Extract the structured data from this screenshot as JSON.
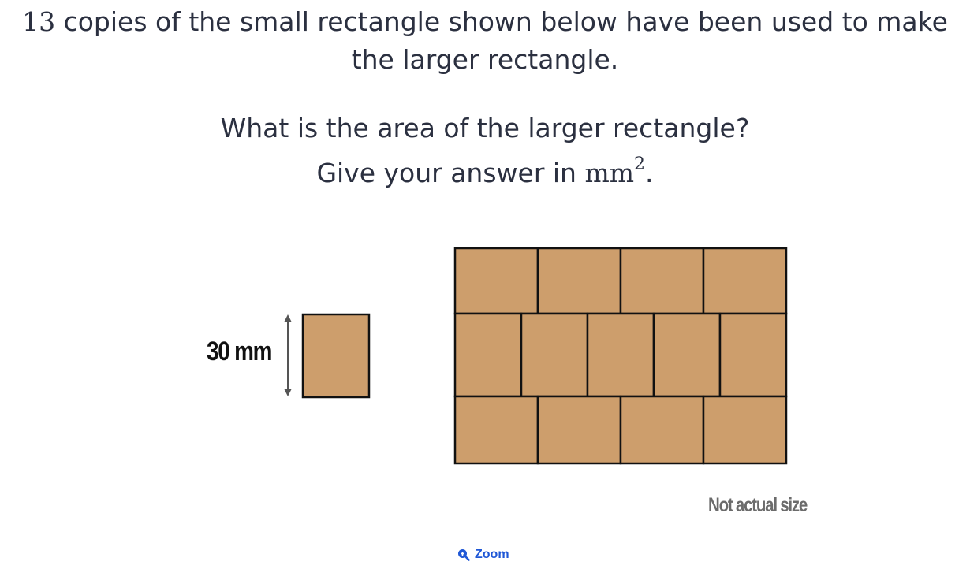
{
  "question": {
    "count": "13",
    "text": " copies of the small rectangle shown below have been used to make the larger rectangle."
  },
  "prompt": {
    "line1": "What is the area of the larger rectangle?",
    "line2_prefix": "Give your answer in ",
    "unit": "mm",
    "unit_power": "2",
    "line2_suffix": "."
  },
  "figure": {
    "small_rectangle_label": "30 mm",
    "note": "Not actual size",
    "fill_color": "#cd9e6c",
    "stroke_color": "#111111",
    "arrow_color": "#555555",
    "rows": [
      {
        "tiles": 4
      },
      {
        "tiles": 5
      },
      {
        "tiles": 4
      }
    ]
  },
  "zoom": {
    "label": "Zoom",
    "icon": "zoom-in-icon",
    "color": "#1f57d6"
  }
}
